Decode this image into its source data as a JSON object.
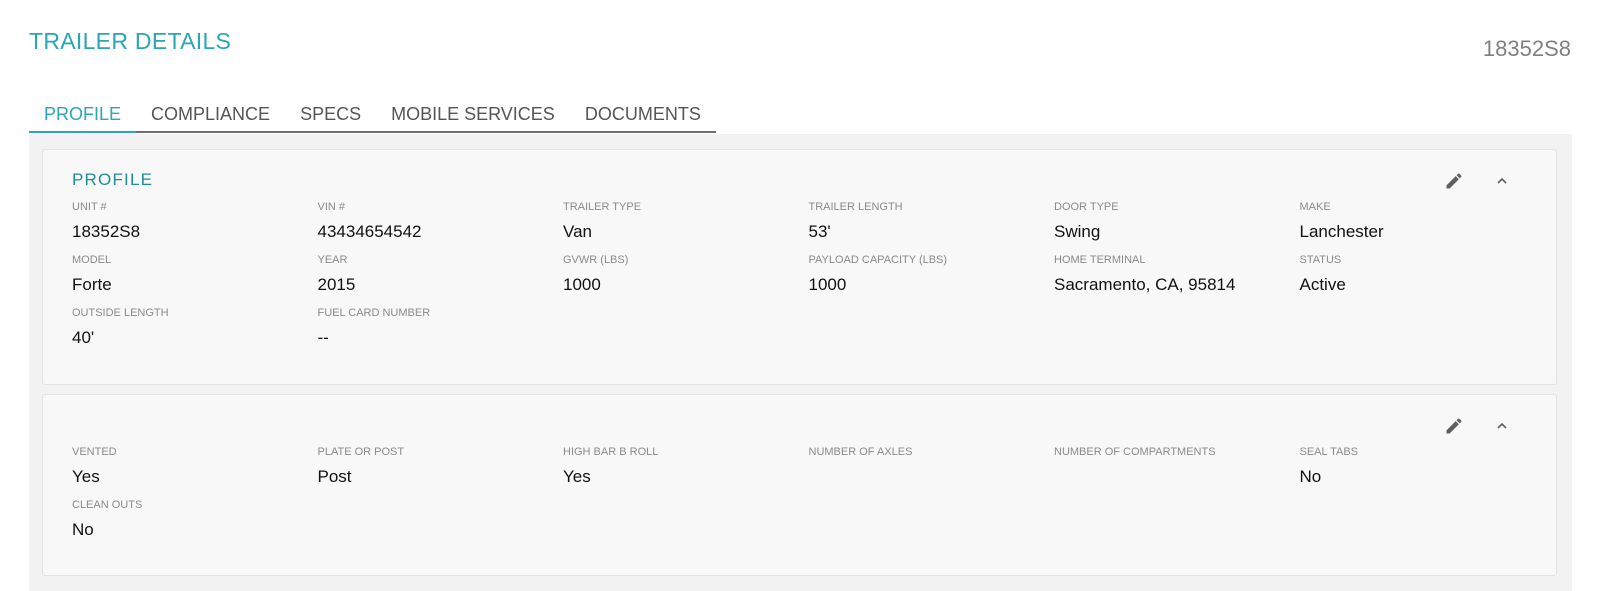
{
  "header": {
    "title": "TRAILER DETAILS",
    "unit_id": "18352S8"
  },
  "tabs": [
    {
      "label": "PROFILE",
      "active": true
    },
    {
      "label": "COMPLIANCE",
      "active": false
    },
    {
      "label": "SPECS",
      "active": false
    },
    {
      "label": "MOBILE SERVICES",
      "active": false
    },
    {
      "label": "DOCUMENTS",
      "active": false
    }
  ],
  "profile_card": {
    "title": "PROFILE",
    "edit_icon": "pencil-icon",
    "collapse_icon": "chevron-up-icon",
    "fields": [
      {
        "label": "UNIT #",
        "value": "18352S8"
      },
      {
        "label": "VIN #",
        "value": "43434654542"
      },
      {
        "label": "TRAILER TYPE",
        "value": "Van"
      },
      {
        "label": "TRAILER LENGTH",
        "value": "53'"
      },
      {
        "label": "DOOR TYPE",
        "value": "Swing"
      },
      {
        "label": "MAKE",
        "value": "Lanchester"
      },
      {
        "label": "MODEL",
        "value": "Forte"
      },
      {
        "label": "YEAR",
        "value": "2015"
      },
      {
        "label": "GVWR (LBS)",
        "value": "1000"
      },
      {
        "label": "PAYLOAD CAPACITY (LBS)",
        "value": "1000"
      },
      {
        "label": "HOME TERMINAL",
        "value": "Sacramento, CA, 95814"
      },
      {
        "label": "STATUS",
        "value": "Active"
      },
      {
        "label": "OUTSIDE LENGTH",
        "value": "40'"
      },
      {
        "label": "FUEL CARD NUMBER",
        "value": "--"
      }
    ]
  },
  "details_card": {
    "edit_icon": "pencil-icon",
    "collapse_icon": "chevron-up-icon",
    "fields": [
      {
        "label": "VENTED",
        "value": "Yes"
      },
      {
        "label": "PLATE OR POST",
        "value": "Post"
      },
      {
        "label": "HIGH BAR B ROLL",
        "value": "Yes"
      },
      {
        "label": "NUMBER OF AXLES",
        "value": ""
      },
      {
        "label": "NUMBER OF COMPARTMENTS",
        "value": ""
      },
      {
        "label": "SEAL TABS",
        "value": "No"
      },
      {
        "label": "CLEAN OUTS",
        "value": "No"
      }
    ]
  },
  "colors": {
    "accent": "#2aa6b4",
    "card_title": "#1f8e96",
    "label": "#8a8a8a",
    "tab_text": "#555555"
  }
}
